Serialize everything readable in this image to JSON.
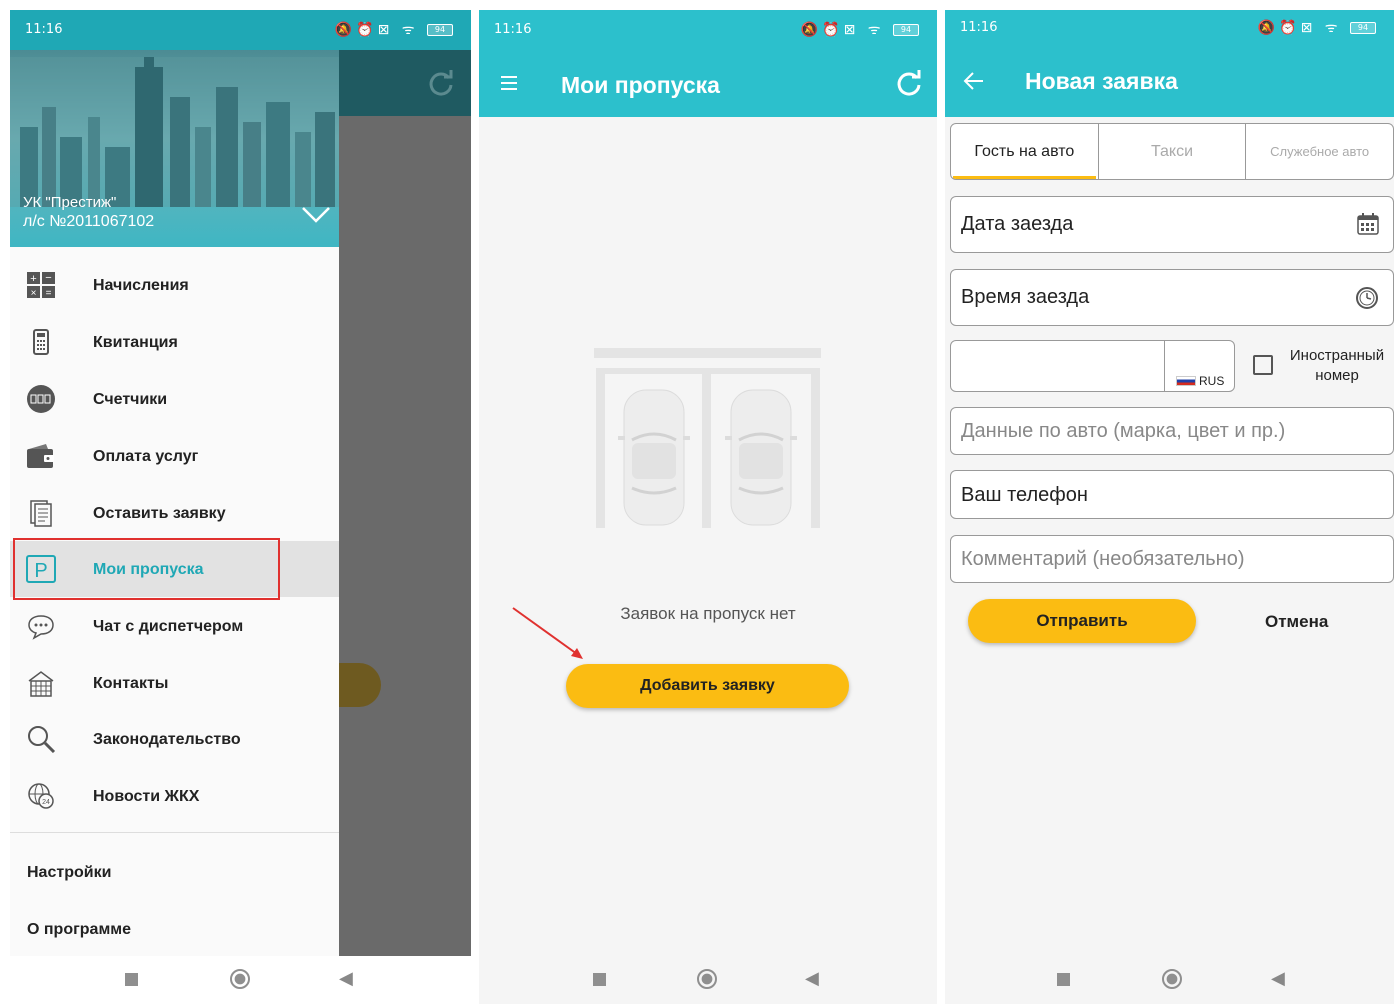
{
  "status": {
    "time": "11:16",
    "battery": "94"
  },
  "drawer": {
    "org": "УК \"Престиж\"",
    "account": "л/с №2011067102",
    "items": [
      {
        "label": "Начисления",
        "icon": "calculator-icon"
      },
      {
        "label": "Квитанция",
        "icon": "receipt-icon"
      },
      {
        "label": "Счетчики",
        "icon": "meter-icon"
      },
      {
        "label": "Оплата услуг",
        "icon": "wallet-icon"
      },
      {
        "label": "Оставить заявку",
        "icon": "document-icon"
      },
      {
        "label": "Мои пропуска",
        "icon": "parking-icon",
        "active": true
      },
      {
        "label": "Чат с диспетчером",
        "icon": "chat-icon"
      },
      {
        "label": "Контакты",
        "icon": "building-icon"
      },
      {
        "label": "Законодательство",
        "icon": "magnifier-icon"
      },
      {
        "label": "Новости ЖКХ",
        "icon": "globe-24-icon"
      }
    ],
    "settings": "Настройки",
    "about": "О программе"
  },
  "passes": {
    "title": "Мои пропуска",
    "empty_text": "Заявок на пропуск нет",
    "add_button": "Добавить заявку"
  },
  "new_request": {
    "title": "Новая заявка",
    "tabs": [
      "Гость на авто",
      "Такси",
      "Служебное авто"
    ],
    "active_tab": 0,
    "date_field": "Дата заезда",
    "time_field": "Время заезда",
    "plate_region": "RUS",
    "foreign_plate": "Иностранный номер",
    "car_data_placeholder": "Данные по авто (марка, цвет и пр.)",
    "phone_field": "Ваш телефон",
    "comment_placeholder": "Комментарий (необязательно)",
    "submit_button": "Отправить",
    "cancel_button": "Отмена"
  },
  "colors": {
    "accent": "#2cc0cc",
    "button": "#fbbc12",
    "highlight": "#e0312f"
  }
}
